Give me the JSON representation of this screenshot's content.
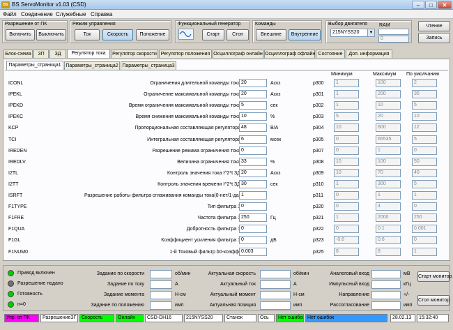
{
  "window": {
    "title": "BS ServoMonitor v1.03 (CSD)",
    "logo": "BS",
    "minimize": "–",
    "maximize": "□",
    "close": "✕"
  },
  "menu": [
    "Файл",
    "Соединение",
    "Служебные",
    "Справка"
  ],
  "toolbar": {
    "pc_group": {
      "label": "Разрешение от ПК",
      "on": "Включить",
      "off": "Выключить"
    },
    "mode_group": {
      "label": "Режим управления",
      "torque": "Ток",
      "speed": "Скорость",
      "position": "Положение"
    },
    "gen_group": {
      "label": "Функциональный генератор",
      "start": "Старт",
      "stop": "Стоп"
    },
    "cmd_group": {
      "label": "Команды",
      "external": "Внешние",
      "internal": "Внутренние"
    },
    "motor_group": {
      "label": "Выбор двигателя",
      "selected": "215NYSS20",
      "ram_label": "RAM",
      "ram_value": "",
      "ram_count": "0"
    },
    "read": "Чтение",
    "write": "Запись"
  },
  "main_tabs": [
    "Блок-схема",
    "ЗП",
    "ЗД",
    "Регулятор тока",
    "Регулятор скорости",
    "Регулятор положения",
    "Осциллограф онлайн",
    "Осциллограф офлайн",
    "Состояние",
    "Доп. информация"
  ],
  "sub_tabs": [
    "Параметры_страница1",
    "Параметры_страница2",
    "Параметры_страница3"
  ],
  "columns": {
    "min": "Минимум",
    "max": "Максимум",
    "default": "По умолчанию"
  },
  "params": [
    {
      "id": "ICONL",
      "desc": "Ограничения длительной команды тока",
      "value": "20",
      "unit": "Аскз",
      "code": "р300",
      "min": "1",
      "max": "100",
      "def": "2"
    },
    {
      "id": "IPEKL",
      "desc": "Ограничение максимальной команды тока",
      "value": "20",
      "unit": "Аскз",
      "code": "р301",
      "min": "1",
      "max": "200",
      "def": "35"
    },
    {
      "id": "IPEKD",
      "desc": "Время ограничения максимальной команды тока",
      "value": "5",
      "unit": "сек",
      "code": "р302",
      "min": "1",
      "max": "10",
      "def": "5"
    },
    {
      "id": "IPEKC",
      "desc": "Время снижения максимальной команды тока",
      "value": "10",
      "unit": "%",
      "code": "р303",
      "min": "5",
      "max": "20",
      "def": "10"
    },
    {
      "id": "KCP",
      "desc": "Пропорциональная составляющая регулятора",
      "value": "48",
      "unit": "В/А",
      "code": "р304",
      "min": "10",
      "max": "600",
      "def": "12"
    },
    {
      "id": "TCI",
      "desc": "Интегральная составляющая регулятора",
      "value": "6",
      "unit": "мсек",
      "code": "р305",
      "min": "0",
      "max": "65535",
      "def": "5"
    },
    {
      "id": "IREDEN",
      "desc": "Разрешение режима ограничения тока",
      "value": "0",
      "unit": "",
      "code": "р307",
      "min": "0",
      "max": "1",
      "def": "0"
    },
    {
      "id": "IREDLV",
      "desc": "Величина ограничения тока",
      "value": "33",
      "unit": "%",
      "code": "р308",
      "min": "10",
      "max": "100",
      "def": "50"
    },
    {
      "id": "I2TL",
      "desc": "Контроль значения тока I^2*t ЗД",
      "value": "20",
      "unit": "Аскз",
      "code": "р309",
      "min": "10",
      "max": "70",
      "def": "40"
    },
    {
      "id": "I2TT",
      "desc": "Контроль значения времени I^2*t ЗД",
      "value": "30",
      "unit": "сек",
      "code": "р310",
      "min": "1",
      "max": "300",
      "def": "5"
    },
    {
      "id": "ISRFT",
      "desc": "Разрешение работы фильтра сглаживания команды тока(0-нет/1-да)",
      "value": "1",
      "unit": "",
      "code": "р311",
      "min": "0",
      "max": "1",
      "def": "1"
    },
    {
      "id": "F1TYPE",
      "desc": "Тип фильтра 1",
      "value": "0",
      "unit": "",
      "code": "р320",
      "min": "0",
      "max": "4",
      "def": "0"
    },
    {
      "id": "F1FRE",
      "desc": "Частота фильтра 1",
      "value": "250",
      "unit": "Гц",
      "code": "р321",
      "min": "1",
      "max": "2000",
      "def": "250"
    },
    {
      "id": "F1QUA",
      "desc": "Добротность фильтра 1",
      "value": "0",
      "unit": "",
      "code": "р322",
      "min": "0",
      "max": "0.1",
      "def": "0.001"
    },
    {
      "id": "F1GL",
      "desc": "Коэффициент усиления фильтра 1",
      "value": "0",
      "unit": "дБ",
      "code": "р323",
      "min": "-0.6",
      "max": "0.6",
      "def": "0"
    },
    {
      "id": "F1NUM0",
      "desc": "1-й Токовый фильтр b0-коэфф.",
      "value": "0.003",
      "unit": "",
      "code": "р325",
      "min": "8",
      "max": "8",
      "def": "1"
    }
  ],
  "bottom": {
    "indicators": [
      {
        "label": "Привод включен",
        "color": "#00d000"
      },
      {
        "label": "Разрешение подано",
        "color": "#707070"
      },
      {
        "label": "Готовность",
        "color": "#00d000"
      },
      {
        "label": "n=0",
        "color": "#00d000"
      }
    ],
    "col1": [
      {
        "label": "Задание по скорости",
        "unit": "об/мин"
      },
      {
        "label": "Задание по току",
        "unit": "А"
      },
      {
        "label": "Задание момента",
        "unit": "Н-см"
      },
      {
        "label": "Задание по положению",
        "unit": "имп"
      }
    ],
    "col2": [
      {
        "label": "Актуальная скорость",
        "unit": "об/мин"
      },
      {
        "label": "Актуальный ток",
        "unit": "А"
      },
      {
        "label": "Актуальный момент",
        "unit": "Н-см"
      },
      {
        "label": "Актуальная позиция",
        "unit": "имп"
      }
    ],
    "col3": [
      {
        "label": "Аналоговый вход",
        "unit": "мВ"
      },
      {
        "label": "Импульсный вход",
        "unit": "кГц"
      },
      {
        "label": "Направление",
        "unit": "+/-"
      },
      {
        "label": "Рассогласование",
        "unit": "имп"
      }
    ],
    "start_monitor": "Старт монитор",
    "stop_monitor": "Стоп монитор"
  },
  "statusbar": {
    "cells": [
      "Упр. от ПК",
      "РазрешениеЗГ",
      "Скорость",
      "Онлайн",
      "CSD-DH16",
      "215NYSS20",
      "Станок",
      "Ось",
      "Нет ошибок",
      "Нет ошибок",
      "28.02.13",
      "15:32:40"
    ],
    "colors": [
      "#ff00ff",
      "#ffffff",
      "#00ff00",
      "#00ff00",
      "#ffffff",
      "#ffffff",
      "#ffffff",
      "#ffffff",
      "#00ff00",
      "#3399ff",
      "#ffffff",
      "#ffffff"
    ]
  }
}
